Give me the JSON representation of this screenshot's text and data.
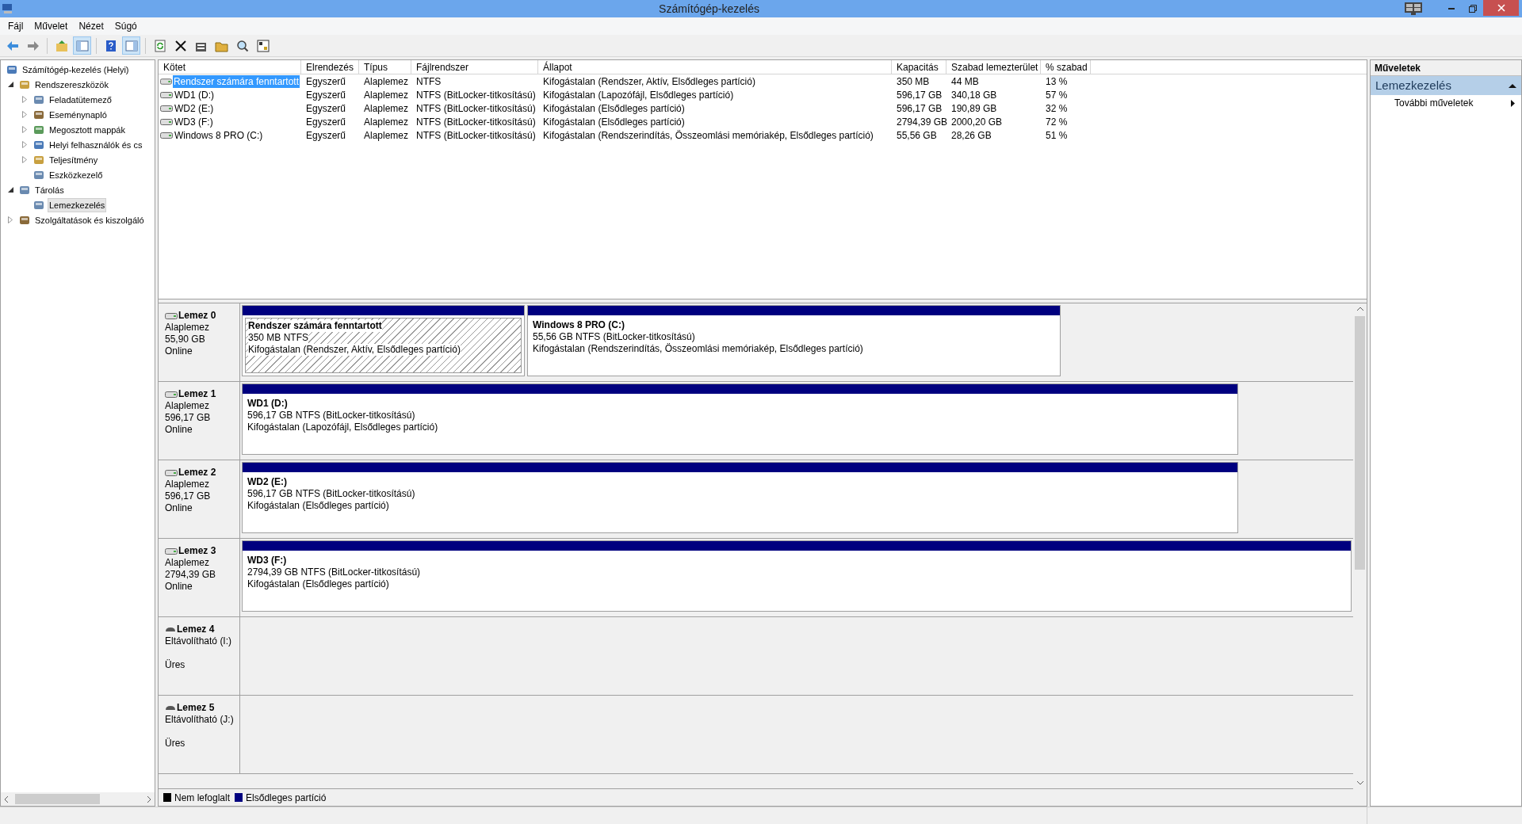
{
  "window": {
    "title": "Számítógép-kezelés"
  },
  "menu": [
    "Fájl",
    "Művelet",
    "Nézet",
    "Súgó"
  ],
  "toolbar": [
    {
      "kind": "back",
      "pressed": false
    },
    {
      "kind": "forward",
      "pressed": false
    },
    {
      "kind": "sep"
    },
    {
      "kind": "up",
      "pressed": false
    },
    {
      "kind": "tree",
      "pressed": true
    },
    {
      "kind": "sep"
    },
    {
      "kind": "help",
      "pressed": false
    },
    {
      "kind": "pane",
      "pressed": true
    },
    {
      "kind": "sep"
    },
    {
      "kind": "refresh",
      "pressed": false
    },
    {
      "kind": "delete",
      "pressed": false
    },
    {
      "kind": "properties",
      "pressed": false
    },
    {
      "kind": "open",
      "pressed": false
    },
    {
      "kind": "find",
      "pressed": false
    },
    {
      "kind": "settings",
      "pressed": false
    }
  ],
  "tree": [
    {
      "label": "Számítógép-kezelés (Helyi)",
      "selected": false,
      "children": [
        {
          "label": "Rendszereszközök",
          "selected": false,
          "expanded": true,
          "children": [
            {
              "label": "Feladatütemező",
              "selected": false,
              "expanded": false
            },
            {
              "label": "Eseménynapló",
              "selected": false,
              "expanded": false
            },
            {
              "label": "Megosztott mappák",
              "selected": false,
              "expanded": false
            },
            {
              "label": "Helyi felhasználók és cs",
              "selected": false,
              "expanded": false
            },
            {
              "label": "Teljesítmény",
              "selected": false,
              "expanded": false
            },
            {
              "label": "Eszközkezelő",
              "selected": false
            }
          ]
        },
        {
          "label": "Tárolás",
          "selected": false,
          "expanded": true,
          "children": [
            {
              "label": "Lemezkezelés",
              "selected": true
            }
          ]
        },
        {
          "label": "Szolgáltatások és kiszolgáló",
          "selected": false,
          "expanded": false
        }
      ]
    }
  ],
  "table": {
    "columns": [
      "Kötet",
      "Elrendezés",
      "Típus",
      "Fájlrendszer",
      "Állapot",
      "Kapacitás",
      "Szabad lemezterület",
      "% szabad"
    ],
    "rows": [
      {
        "selected": true,
        "cells": [
          "Rendszer számára fenntartott",
          "Egyszerű",
          "Alaplemez",
          "NTFS",
          "Kifogástalan (Rendszer, Aktív, Elsődleges partíció)",
          "350 MB",
          "44 MB",
          "13 %"
        ]
      },
      {
        "selected": false,
        "cells": [
          "WD1 (D:)",
          "Egyszerű",
          "Alaplemez",
          "NTFS (BitLocker-titkosítású)",
          "Kifogástalan (Lapozófájl, Elsődleges partíció)",
          "596,17 GB",
          "340,18 GB",
          "57 %"
        ]
      },
      {
        "selected": false,
        "cells": [
          "WD2 (E:)",
          "Egyszerű",
          "Alaplemez",
          "NTFS (BitLocker-titkosítású)",
          "Kifogástalan (Elsődleges partíció)",
          "596,17 GB",
          "190,89 GB",
          "32 %"
        ]
      },
      {
        "selected": false,
        "cells": [
          "WD3 (F:)",
          "Egyszerű",
          "Alaplemez",
          "NTFS (BitLocker-titkosítású)",
          "Kifogástalan (Elsődleges partíció)",
          "2794,39 GB",
          "2000,20 GB",
          "72 %"
        ]
      },
      {
        "selected": false,
        "cells": [
          "Windows 8 PRO (C:)",
          "Egyszerű",
          "Alaplemez",
          "NTFS (BitLocker-titkosítású)",
          "Kifogástalan (Rendszerindítás, Összeomlási memóriakép, Elsődleges partíció)",
          "55,56 GB",
          "28,26 GB",
          "51 %"
        ]
      }
    ]
  },
  "disks": [
    {
      "kind": "fixed",
      "name": "Lemez 0",
      "type": "Alaplemez",
      "size": "55,90 GB",
      "status": "Online",
      "partitions": [
        {
          "selected": true,
          "name": "Rendszer számára fenntartott",
          "fs": "350 MB NTFS",
          "status": "Kifogástalan (Rendszer, Aktív, Elsődleges partíció)"
        },
        {
          "selected": false,
          "name": "Windows 8 PRO  (C:)",
          "fs": "55,56 GB NTFS (BitLocker-titkosítású)",
          "status": "Kifogástalan (Rendszerindítás, Összeomlási memóriakép, Elsődleges partíció)"
        }
      ]
    },
    {
      "kind": "fixed",
      "name": "Lemez 1",
      "type": "Alaplemez",
      "size": "596,17 GB",
      "status": "Online",
      "partitions": [
        {
          "selected": false,
          "name": "WD1  (D:)",
          "fs": "596,17 GB NTFS (BitLocker-titkosítású)",
          "status": "Kifogástalan (Lapozófájl, Elsődleges partíció)"
        }
      ]
    },
    {
      "kind": "fixed",
      "name": "Lemez 2",
      "type": "Alaplemez",
      "size": "596,17 GB",
      "status": "Online",
      "partitions": [
        {
          "selected": false,
          "name": "WD2  (E:)",
          "fs": "596,17 GB NTFS (BitLocker-titkosítású)",
          "status": "Kifogástalan (Elsődleges partíció)"
        }
      ]
    },
    {
      "kind": "fixed",
      "name": "Lemez 3",
      "type": "Alaplemez",
      "size": "2794,39 GB",
      "status": "Online",
      "partitions": [
        {
          "selected": false,
          "name": "WD3  (F:)",
          "fs": "2794,39 GB NTFS (BitLocker-titkosítású)",
          "status": "Kifogástalan (Elsődleges partíció)"
        }
      ]
    },
    {
      "kind": "removable",
      "name": "Lemez 4",
      "type": "Eltávolítható (I:)",
      "status": "Üres"
    },
    {
      "kind": "removable",
      "name": "Lemez 5",
      "type": "Eltávolítható (J:)",
      "status": "Üres"
    }
  ],
  "legend": [
    {
      "label": "Nem lefoglalt",
      "color": "#000000"
    },
    {
      "label": "Elsődleges partíció",
      "color": "#00007f"
    }
  ],
  "actions": {
    "title": "Műveletek",
    "section": {
      "label": "Lemezkezelés",
      "expanded": true
    },
    "items": [
      "További műveletek"
    ]
  }
}
